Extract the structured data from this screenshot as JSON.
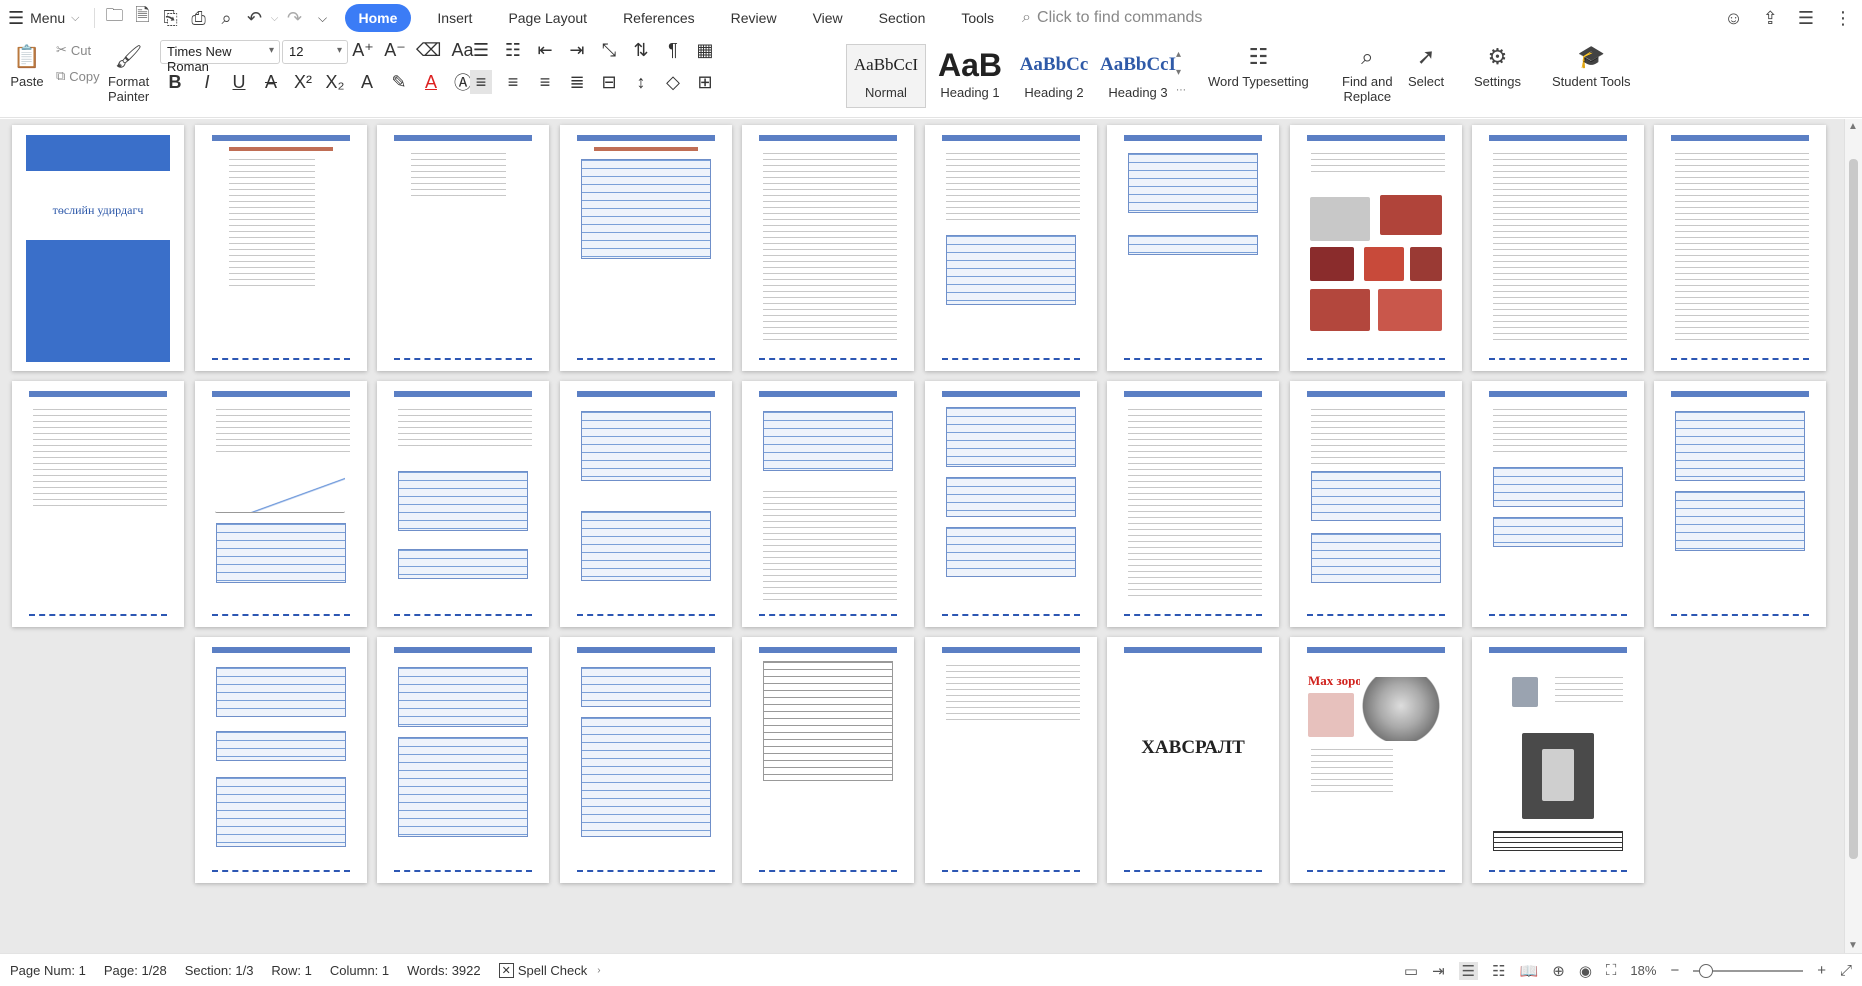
{
  "topbar": {
    "menu_label": "Menu",
    "tabs": [
      {
        "label": "Home",
        "active": true
      },
      {
        "label": "Insert"
      },
      {
        "label": "Page Layout"
      },
      {
        "label": "References"
      },
      {
        "label": "Review"
      },
      {
        "label": "View"
      },
      {
        "label": "Section"
      },
      {
        "label": "Tools"
      }
    ],
    "command_search": "Click to find commands"
  },
  "ribbon": {
    "paste": "Paste",
    "cut": "Cut",
    "copy": "Copy",
    "format_painter_1": "Format",
    "format_painter_2": "Painter",
    "font_name": "Times New Roman",
    "font_size": "12",
    "styles": [
      {
        "preview": "AaBbCcI",
        "name": "Normal"
      },
      {
        "preview": "AaB",
        "name": "Heading 1"
      },
      {
        "preview": "AaBbCc",
        "name": "Heading 2"
      },
      {
        "preview": "AaBbCcI",
        "name": "Heading 3"
      }
    ],
    "word_typesetting": "Word Typesetting",
    "find_replace_1": "Find and",
    "find_replace_2": "Replace",
    "select": "Select",
    "settings": "Settings",
    "student_tools": "Student Tools"
  },
  "document": {
    "cover_title": "төслийн удирдагч",
    "appendix_title": "ХАВСРАЛТ",
    "ad_title": "Мах зорогч"
  },
  "status": {
    "page_num": "Page Num: 1",
    "page": "Page: 1/28",
    "section": "Section: 1/3",
    "row": "Row: 1",
    "column": "Column: 1",
    "words": "Words: 3922",
    "spell_check": "Spell Check",
    "zoom": "18%"
  },
  "colors": {
    "accent": "#3b7cf6",
    "header_bar": "#5b7fc4",
    "cover_blue": "#3a6fc9"
  }
}
